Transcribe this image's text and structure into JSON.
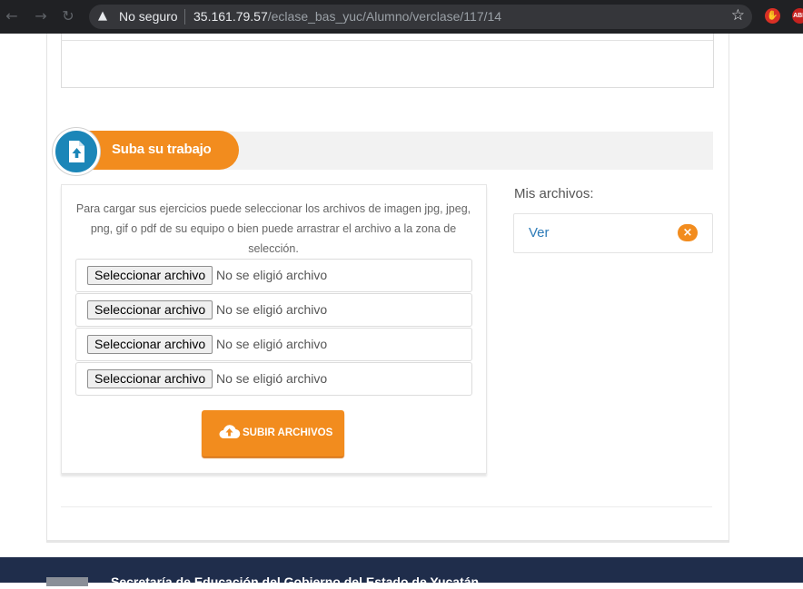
{
  "browser": {
    "security_label": "No seguro",
    "url_host": "35.161.79.57",
    "url_path": "/eclase_bas_yuc/Alumno/verclase/117/14",
    "ext_label": "ABP"
  },
  "section": {
    "title": "Suba su trabajo"
  },
  "upload": {
    "instructions": "Para cargar sus ejercicios puede seleccionar los archivos de imagen jpg, jpeg, png, gif o pdf de su equipo o bien puede arrastrar el archivo a la zona de selección.",
    "file_inputs": [
      {
        "button": "Seleccionar archivo",
        "status": "No se eligió archivo"
      },
      {
        "button": "Seleccionar archivo",
        "status": "No se eligió archivo"
      },
      {
        "button": "Seleccionar archivo",
        "status": "No se eligió archivo"
      },
      {
        "button": "Seleccionar archivo",
        "status": "No se eligió archivo"
      }
    ],
    "submit_label": "SUBIR ARCHIVOS"
  },
  "mis_archivos": {
    "title": "Mis archivos:",
    "items": [
      {
        "label": "Ver"
      }
    ]
  },
  "footer": {
    "text": "Secretaría de Educación del Gobierno del Estado de Yucatán"
  },
  "colors": {
    "accent": "#f28c1e",
    "icon_blue": "#1b86b8",
    "footer": "#1f2d4b"
  }
}
